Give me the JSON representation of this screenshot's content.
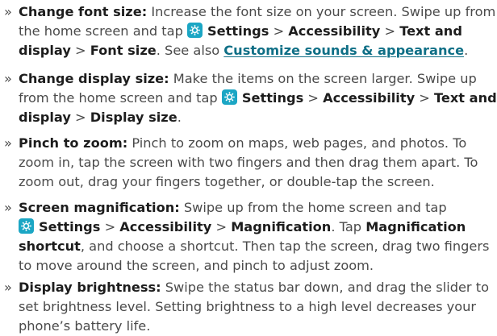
{
  "bullet": "»",
  "colors": {
    "text": "#4a4a4a",
    "bold": "#1d1d1d",
    "link": "#0f6f86",
    "icon_bg": "#1ba6c4"
  },
  "icon": "settings-gear-icon",
  "items": [
    {
      "lines": [
        [
          "Change font size:",
          " Increase the font size on your screen. Swipe up from"
        ],
        [
          "the home screen and tap ",
          "Settings",
          " > ",
          "Accessibility",
          " > ",
          "Text and"
        ],
        [
          "display",
          " > ",
          "Font size",
          ". See also ",
          "Customize sounds & appearance",
          "."
        ]
      ]
    },
    {
      "lines": [
        [
          "Change display size:",
          " Make the items on the screen larger. Swipe up"
        ],
        [
          "from the home screen and tap ",
          "Settings",
          " > ",
          "Accessibility",
          " > ",
          "Text and"
        ],
        [
          "display",
          " > ",
          "Display size",
          "."
        ]
      ]
    },
    {
      "lines": [
        [
          "Pinch to zoom:",
          " Pinch to zoom on maps, web pages, and photos. To"
        ],
        [
          "zoom in, tap the screen with two fingers and then drag them apart. To"
        ],
        [
          "zoom out, drag your fingers together, or double-tap the screen."
        ]
      ]
    },
    {
      "lines": [
        [
          "Screen magnification:",
          " Swipe up from the home screen and tap"
        ],
        [
          "Settings",
          " > ",
          "Accessibility",
          " > ",
          "Magnification",
          ". Tap ",
          "Magnification"
        ],
        [
          "shortcut",
          ", and choose a shortcut. Then tap the screen, drag two fingers"
        ],
        [
          "to move around the screen, and pinch to adjust zoom."
        ]
      ]
    },
    {
      "lines": [
        [
          "Display brightness:",
          " Swipe the status bar down, and drag the slider to"
        ],
        [
          "set brightness level. Setting brightness to a high level decreases your"
        ],
        [
          "phone’s battery life."
        ]
      ]
    }
  ]
}
